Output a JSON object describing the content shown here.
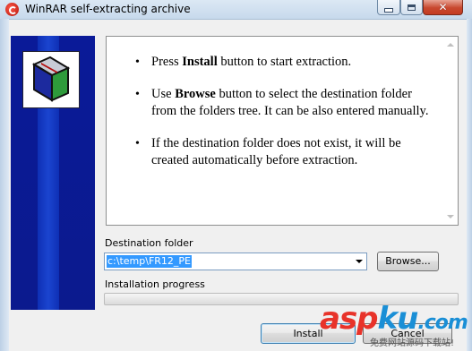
{
  "window": {
    "title": "WinRAR self-extracting archive",
    "controls": {
      "minimize": "minimize",
      "maximize": "maximize",
      "close": "close"
    }
  },
  "info": {
    "bullets": [
      {
        "before": "Press ",
        "bold": "Install",
        "after": " button to start extraction."
      },
      {
        "before": "Use ",
        "bold": "Browse",
        "after": " button to select the destination folder from the folders tree. It can be also entered manually."
      },
      {
        "before": "If the destination folder does not exist, it will be created automatically before extraction.",
        "bold": "",
        "after": ""
      }
    ]
  },
  "destination": {
    "label": "Destination folder",
    "value": "c:\\temp\\FR12_PE",
    "browse_label": "Browse..."
  },
  "progress": {
    "label": "Installation progress",
    "percent": 0
  },
  "buttons": {
    "install_label": "Install",
    "cancel_label": "Cancel"
  },
  "watermark": {
    "asp": "asp",
    "ku": "ku",
    "com": ".com",
    "subtitle": "免费网站源码下载站!"
  },
  "colors": {
    "banner": "#0a1a98",
    "selection": "#3399ff",
    "watermark_red": "#e8332a",
    "watermark_blue": "#1a8fd6"
  }
}
